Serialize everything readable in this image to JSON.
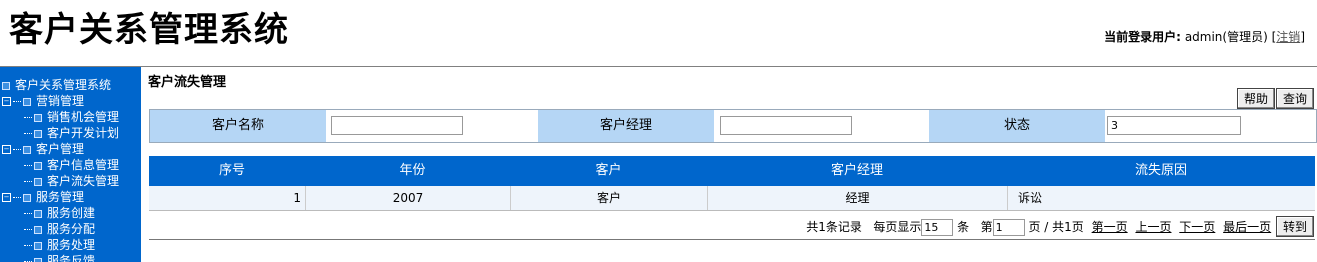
{
  "app_title": "客户关系管理系统",
  "user": {
    "label": "当前登录用户:",
    "name": "admin(管理员)",
    "bracket_open": "[",
    "logout": "注销",
    "bracket_close": "]"
  },
  "sidebar": {
    "root": "客户关系管理系统",
    "groups": [
      {
        "label": "营销管理",
        "items": [
          "销售机会管理",
          "客户开发计划"
        ]
      },
      {
        "label": "客户管理",
        "items": [
          "客户信息管理",
          "客户流失管理"
        ]
      },
      {
        "label": "服务管理",
        "items": [
          "服务创建",
          "服务分配",
          "服务处理",
          "服务反馈"
        ]
      }
    ]
  },
  "page": {
    "title": "客户流失管理",
    "help": "帮助",
    "query": "查询"
  },
  "search": {
    "customer_name_label": "客户名称",
    "customer_name_value": "",
    "manager_label": "客户经理",
    "manager_value": "",
    "status_label": "状态",
    "status_value": "3"
  },
  "table": {
    "headers": [
      "序号",
      "年份",
      "客户",
      "客户经理",
      "流失原因"
    ],
    "rows": [
      {
        "index": "1",
        "year": "2007",
        "customer": "客户",
        "manager": "经理",
        "reason": "诉讼"
      }
    ]
  },
  "pager": {
    "total": "共1条记录",
    "per_page_label": "每页显示",
    "per_page_value": "15",
    "per_page_unit": "条",
    "page_label": "第",
    "page_value": "1",
    "page_suffix": "页 / 共1页",
    "first": "第一页",
    "prev": "上一页",
    "next": "下一页",
    "last": "最后一页",
    "go": "转到"
  },
  "colors": {
    "primary": "#0066cc",
    "label_bg": "#b5d6f5",
    "row_bg": "#eef4fb"
  }
}
